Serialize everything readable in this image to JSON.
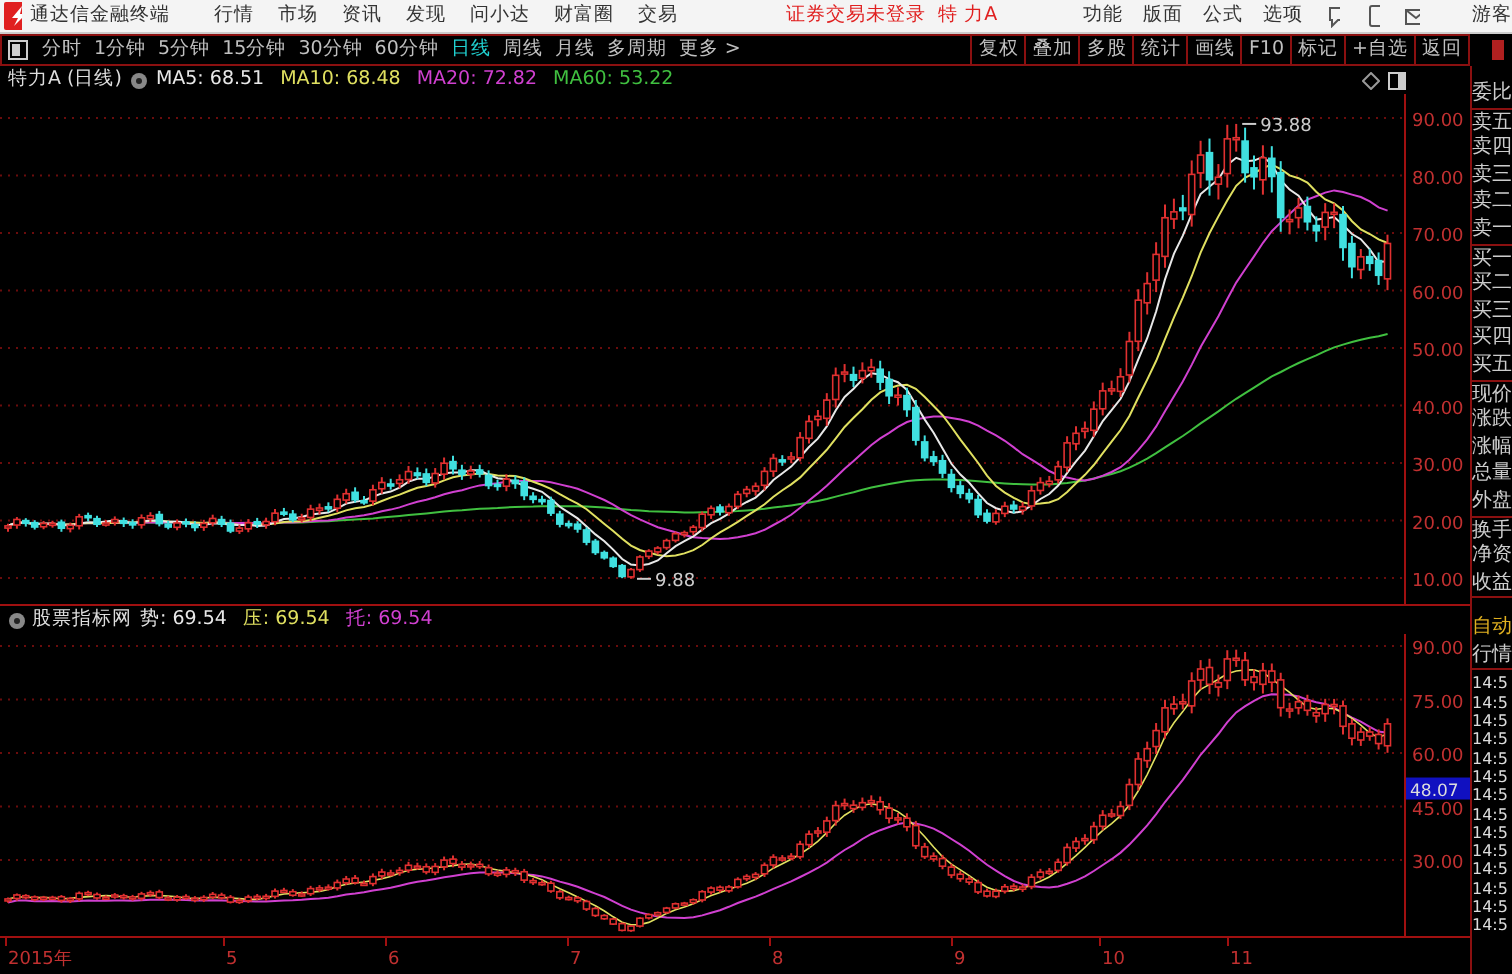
{
  "menu_bar": {
    "app_title": "通达信金融终端",
    "menus": [
      "行情",
      "市场",
      "资讯",
      "发现",
      "问小达",
      "财富圈",
      "交易"
    ],
    "login_status": "证券交易未登录",
    "stock_name": "特 力A",
    "tools": [
      "功能",
      "版面",
      "公式",
      "选项"
    ],
    "user": "游客"
  },
  "period_tabs": [
    {
      "label": "分时",
      "selected": false
    },
    {
      "label": "1分钟",
      "selected": false
    },
    {
      "label": "5分钟",
      "selected": false
    },
    {
      "label": "15分钟",
      "selected": false
    },
    {
      "label": "30分钟",
      "selected": false
    },
    {
      "label": "60分钟",
      "selected": false
    },
    {
      "label": "日线",
      "selected": true
    },
    {
      "label": "周线",
      "selected": false
    },
    {
      "label": "月线",
      "selected": false
    },
    {
      "label": "多周期",
      "selected": false
    },
    {
      "label": "更多 >",
      "selected": false
    }
  ],
  "chart_tools": [
    "复权",
    "叠加",
    "多股",
    "统计",
    "画线",
    "F10",
    "标记",
    "+自选",
    "返回"
  ],
  "chart_header": {
    "title": "特力A (日线)",
    "indicators": [
      {
        "label": "MA5: 68.51",
        "color": "#e8e8e8"
      },
      {
        "label": "MA10: 68.48",
        "color": "#e0e060"
      },
      {
        "label": "MA20: 72.82",
        "color": "#d040d0"
      },
      {
        "label": "MA60: 53.22",
        "color": "#40c040"
      }
    ]
  },
  "price_chart": {
    "y_axis": [
      "90.00",
      "80.00",
      "70.00",
      "60.00",
      "50.00",
      "40.00",
      "30.00",
      "20.00",
      "10.00"
    ],
    "high_label": "93.88",
    "low_label": "9.88"
  },
  "indicator_panel": {
    "name": "股票指标网",
    "values": [
      {
        "label": "势: 69.54",
        "color": "#e8e8e8"
      },
      {
        "label": "压: 69.54",
        "color": "#e0e060"
      },
      {
        "label": "托: 69.54",
        "color": "#d040d0"
      }
    ],
    "y_axis": [
      "90.00",
      "75.00",
      "60.00",
      "45.00",
      "30.00"
    ],
    "current_value": "48.07"
  },
  "x_axis": [
    "2015年",
    "5",
    "6",
    "7",
    "8",
    "9",
    "10",
    "11"
  ],
  "quote_panel": {
    "labels": [
      "委比",
      "卖五",
      "卖四",
      "卖三",
      "卖二",
      "卖一",
      "买一",
      "买二",
      "买三",
      "买四",
      "买五",
      "现价",
      "涨跌",
      "涨幅",
      "总量",
      "外盘",
      "换手",
      "净资",
      "收益"
    ],
    "mode": "自动",
    "section": "行情",
    "times": [
      "14:5",
      "14:5",
      "14:5",
      "14:5",
      "14:5",
      "14:5",
      "14:5",
      "14:5",
      "14:5",
      "14:5",
      "14:5",
      "14:5",
      "14:5",
      "14:5"
    ]
  }
}
